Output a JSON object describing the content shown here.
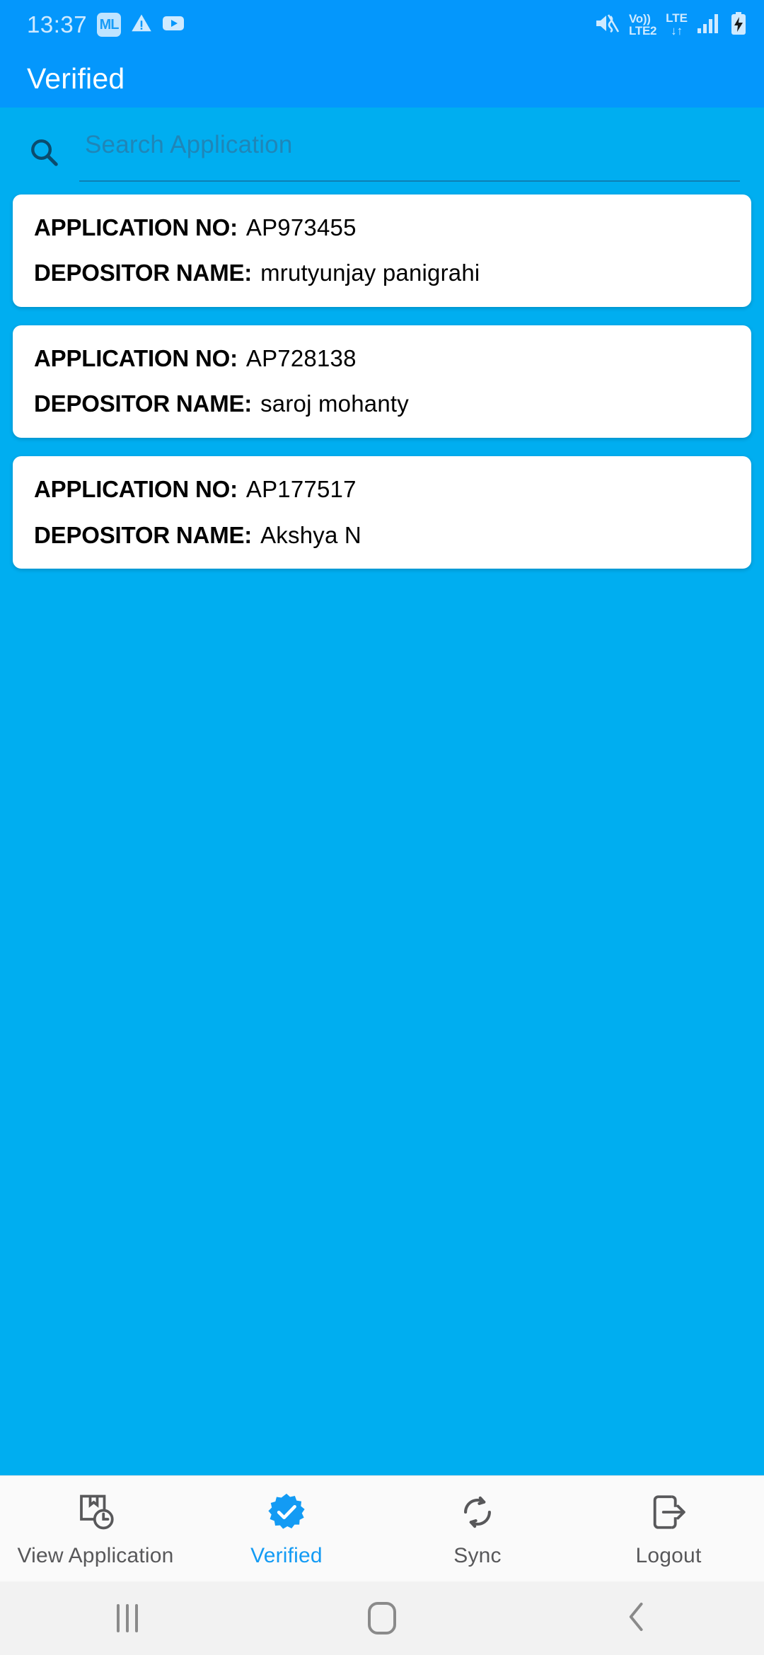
{
  "status_bar": {
    "time": "13:37",
    "left_icons": [
      {
        "name": "ml-app-icon",
        "label": "ML"
      },
      {
        "name": "warning-triangle-icon"
      },
      {
        "name": "youtube-icon"
      }
    ],
    "right_icons": [
      {
        "name": "mute-icon"
      },
      {
        "name": "volte-icon",
        "line1": "Vo))",
        "line2": "LTE2"
      },
      {
        "name": "lte-data-icon",
        "line1": "LTE",
        "line2": "↓↑"
      },
      {
        "name": "signal-bars-icon"
      },
      {
        "name": "battery-charging-icon"
      }
    ]
  },
  "app_bar": {
    "title": "Verified",
    "background": "#0497FC",
    "title_color": "#FFFFFF"
  },
  "search": {
    "icon": "search-icon",
    "placeholder": "Search Application",
    "value": ""
  },
  "list": {
    "label_application_no": "APPLICATION NO:",
    "label_depositor_name": "DEPOSITOR NAME:",
    "items": [
      {
        "application_no": "AP973455",
        "depositor_name": "mrutyunjay panigrahi"
      },
      {
        "application_no": "AP728138",
        "depositor_name": "saroj mohanty"
      },
      {
        "application_no": "AP177517",
        "depositor_name": "Akshya N"
      }
    ]
  },
  "bottom_nav": {
    "active_color": "#139BF4",
    "inactive_color": "#58585A",
    "items": [
      {
        "label": "View Application",
        "icon": "view-application-icon",
        "active": false
      },
      {
        "label": "Verified",
        "icon": "verified-badge-icon",
        "active": true
      },
      {
        "label": "Sync",
        "icon": "sync-icon",
        "active": false
      },
      {
        "label": "Logout",
        "icon": "logout-icon",
        "active": false
      }
    ]
  },
  "system_nav": {
    "items": [
      {
        "name": "recents-button"
      },
      {
        "name": "home-button"
      },
      {
        "name": "back-button"
      }
    ]
  },
  "colors": {
    "app_bar": "#0497FC",
    "body_background": "#00AEF0",
    "card_background": "#FFFFFF",
    "accent": "#139BF4"
  }
}
